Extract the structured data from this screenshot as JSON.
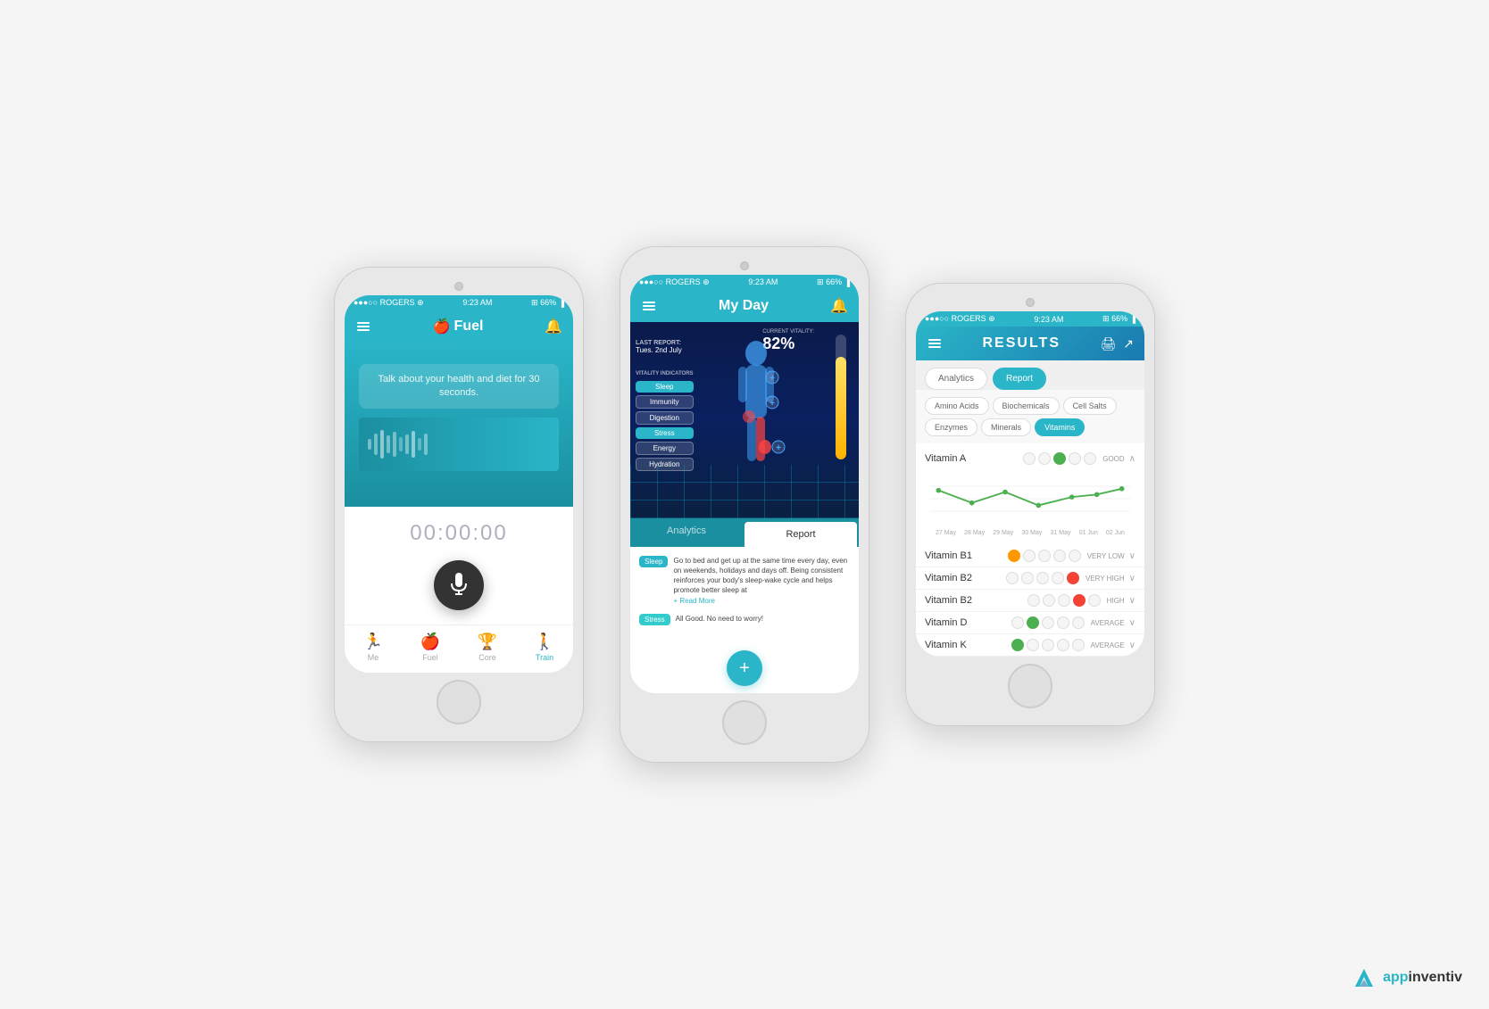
{
  "brand": {
    "name": "appinventiv",
    "logo_symbol": "A"
  },
  "phone1": {
    "status_bar": {
      "carrier": "●●●○○ ROGERS ⊕",
      "time": "9:23 AM",
      "battery": "⊞ 66% ▐"
    },
    "header": {
      "menu": "≡",
      "title": "Fuel",
      "icon": "🍎",
      "notification": "🔔"
    },
    "prompt": "Talk about your health and diet for 30 seconds.",
    "timer": "00:00:00",
    "nav": {
      "items": [
        {
          "icon": "🏃",
          "label": "Me"
        },
        {
          "icon": "🍎",
          "label": "Fuel"
        },
        {
          "icon": "🏆",
          "label": "Core"
        },
        {
          "icon": "🚶",
          "label": "Train"
        }
      ]
    }
  },
  "phone2": {
    "status_bar": {
      "carrier": "●●●○○ ROGERS ⊕",
      "time": "9:23 AM",
      "battery": "⊞ 66% ▐"
    },
    "header": {
      "menu": "≡",
      "title": "My Day",
      "notification": "🔔"
    },
    "body_scan": {
      "last_report_label": "LAST REPORT:",
      "last_report_date": "Tues. 2nd July",
      "vitality_label": "CURRENT VITALITY:",
      "vitality_pct": "82%",
      "indicators_title": "VITALITY INDICATORS",
      "indicators": [
        {
          "label": "Sleep",
          "active": true
        },
        {
          "label": "Immunity",
          "active": false
        },
        {
          "label": "Digestion",
          "active": false
        },
        {
          "label": "Stress",
          "active": true
        },
        {
          "label": "Energy",
          "active": false
        },
        {
          "label": "Hydration",
          "active": false
        }
      ]
    },
    "tabs": [
      "Analytics",
      "Report"
    ],
    "active_tab": "Report",
    "report_items": [
      {
        "badge": "Sleep",
        "text": "Go to bed and get up at the same time every day, even on weekends, holidays and days off. Being consistent reinforces your body's sleep-wake cycle and helps promote better sleep at",
        "read_more": "+ Read More"
      },
      {
        "badge": "Stress",
        "text": "All Good. No need to worry!"
      }
    ],
    "fab_label": "+"
  },
  "phone3": {
    "status_bar": {
      "carrier": "●●●○○ ROGERS ⊕",
      "time": "9:23 AM",
      "battery": "⊞ 66% ▐"
    },
    "header": {
      "menu": "≡",
      "title": "RESULTS"
    },
    "tabs": [
      "Analytics",
      "Report"
    ],
    "active_tab": "Report",
    "categories": [
      "Amino Acids",
      "Biochemicals",
      "Cell Salts",
      "Enzymes",
      "Minerals",
      "Vitamins"
    ],
    "active_category": "Vitamins",
    "chart": {
      "dates": [
        "27 May",
        "28 May",
        "29 May",
        "30 May",
        "31 May",
        "01 Jun",
        "02 Jun"
      ]
    },
    "vitamins": [
      {
        "name": "Vitamin A",
        "dots": [
          "empty",
          "empty",
          "green",
          "empty",
          "empty"
        ],
        "status": "GOOD",
        "expanded": true
      },
      {
        "name": "Vitamin B1",
        "dots": [
          "orange",
          "empty",
          "empty",
          "empty",
          "empty"
        ],
        "status": "VERY LOW",
        "expanded": false
      },
      {
        "name": "Vitamin B2",
        "dots": [
          "empty",
          "empty",
          "empty",
          "empty",
          "red"
        ],
        "status": "VERY HIGH",
        "expanded": false
      },
      {
        "name": "Vitamin B2",
        "dots": [
          "empty",
          "empty",
          "empty",
          "red",
          "empty"
        ],
        "status": "HIGH",
        "expanded": false
      },
      {
        "name": "Vitamin D",
        "dots": [
          "empty",
          "green",
          "empty",
          "empty",
          "empty"
        ],
        "status": "AVERAGE",
        "expanded": false
      },
      {
        "name": "Vitamin K",
        "dots": [
          "green",
          "empty",
          "empty",
          "empty",
          "empty"
        ],
        "status": "AVERAGE",
        "expanded": false
      }
    ]
  }
}
